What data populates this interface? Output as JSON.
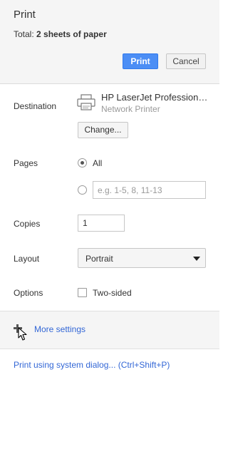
{
  "header": {
    "title": "Print",
    "total_label": "Total:",
    "total_value": "2 sheets of paper",
    "print_button": "Print",
    "cancel_button": "Cancel"
  },
  "destination": {
    "label": "Destination",
    "printer_name": "HP LaserJet Professiona...",
    "printer_type": "Network Printer",
    "change_button": "Change...",
    "icon": "printer-icon"
  },
  "pages": {
    "label": "Pages",
    "all_label": "All",
    "all_selected": true,
    "custom_placeholder": "e.g. 1-5, 8, 11-13",
    "custom_value": ""
  },
  "copies": {
    "label": "Copies",
    "value": "1"
  },
  "layout": {
    "label": "Layout",
    "selected": "Portrait"
  },
  "options": {
    "label": "Options",
    "two_sided_label": "Two-sided",
    "two_sided_checked": false
  },
  "more_settings": {
    "label": "More settings",
    "icon": "plus-icon"
  },
  "system_dialog_link": "Print using system dialog... (Ctrl+Shift+P)"
}
